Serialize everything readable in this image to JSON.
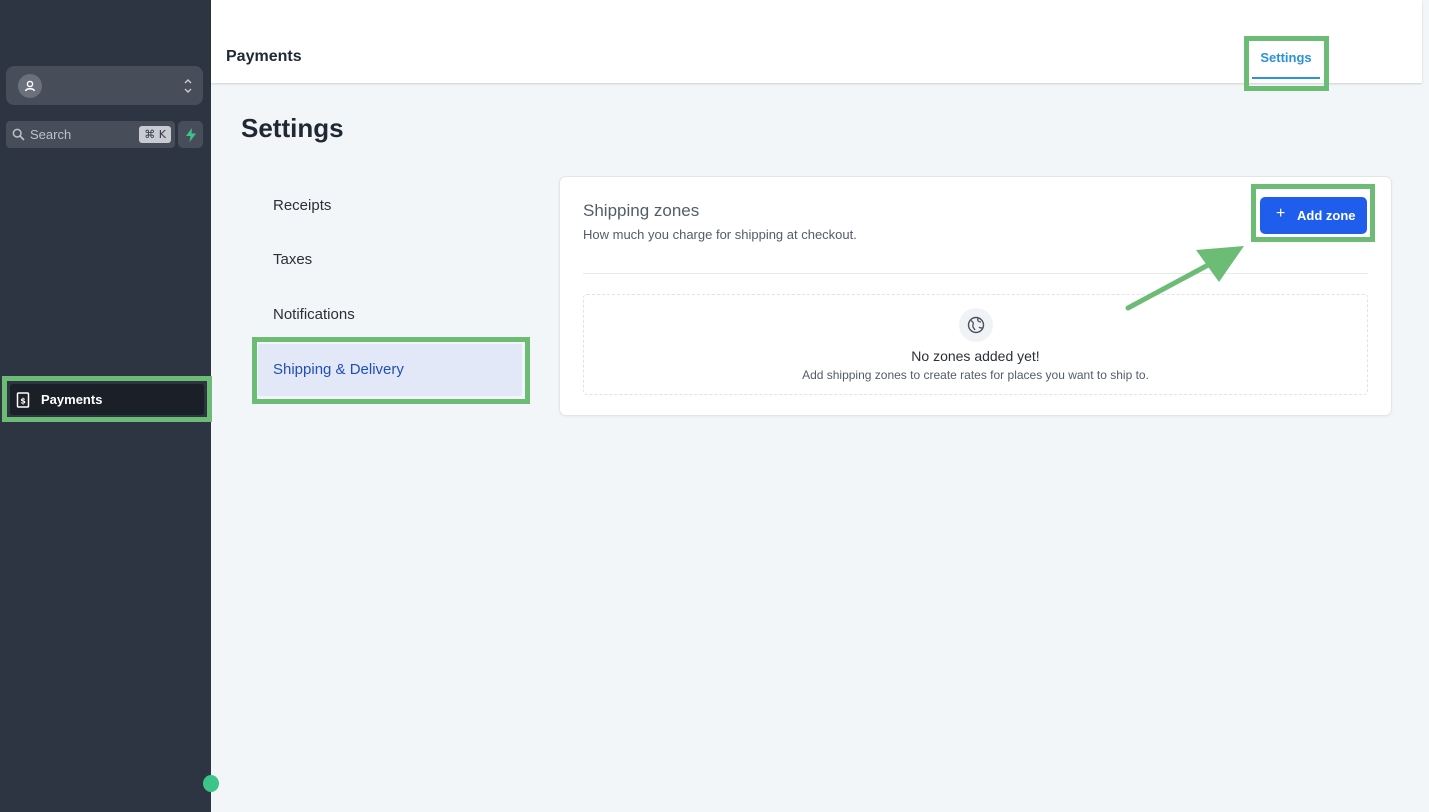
{
  "sidebar": {
    "search": {
      "placeholder": "Search",
      "shortcut": "⌘ K"
    },
    "nav": {
      "payments_label": "Payments"
    }
  },
  "topbar": {
    "page_name": "Payments",
    "tab_label": "Settings"
  },
  "page": {
    "title": "Settings"
  },
  "subnav": {
    "items": [
      "Receipts",
      "Taxes",
      "Notifications",
      "Shipping & Delivery"
    ],
    "active": "Shipping & Delivery"
  },
  "shipping_zones": {
    "title": "Shipping zones",
    "description": "How much you charge for shipping at checkout.",
    "add_button": "Add zone",
    "empty_title": "No zones added yet!",
    "empty_description": "Add shipping zones to create rates for places you want to ship to."
  },
  "colors": {
    "sidebar_bg": "#2e3542",
    "accent": "#1f5eec",
    "tab_active": "#2b93d6",
    "highlight": "#6dbc76"
  },
  "icons": [
    "user-circle-icon",
    "chevrons-up-down-icon",
    "search-icon",
    "bolt-icon",
    "receipt-dollar-icon",
    "plus-icon",
    "globe-icon"
  ]
}
